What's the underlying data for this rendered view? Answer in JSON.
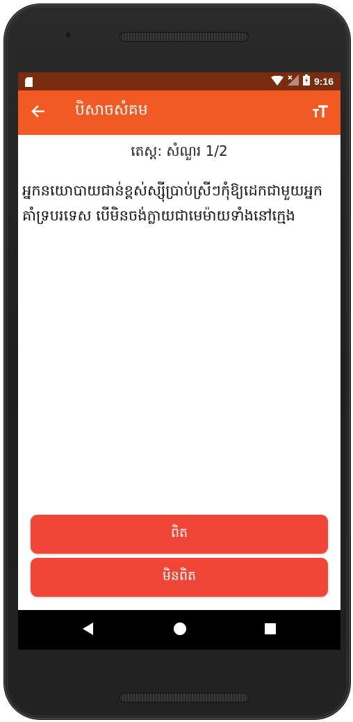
{
  "status_bar": {
    "time": "9:16",
    "icons": [
      "sd-card-icon",
      "wifi-icon",
      "no-signal-icon",
      "battery-icon"
    ]
  },
  "app_bar": {
    "title": "បិសាចសំគម",
    "back_icon": "arrow-left-icon",
    "text_size_icon": "text-size-icon",
    "background_color": "#f25a24"
  },
  "quiz": {
    "header": "តេស្ត: សំណួរ 1/2",
    "question": "អ្នកនយោបាយជាន់ខ្ពស់ស្ស៊ីប្រាប់ស្រីៗកុំឱ្យដេកជាមួយអ្នកគាំទ្របរទេស បើមិនចង់ក្លាយជាមេម៉ាយទាំងនៅក្មេង"
  },
  "answers": {
    "true_label": "ពិត",
    "false_label": "មិនពិត",
    "button_color": "#ef4637"
  },
  "nav_bar": {
    "icons": [
      "nav-back-icon",
      "nav-home-icon",
      "nav-recent-icon"
    ]
  }
}
